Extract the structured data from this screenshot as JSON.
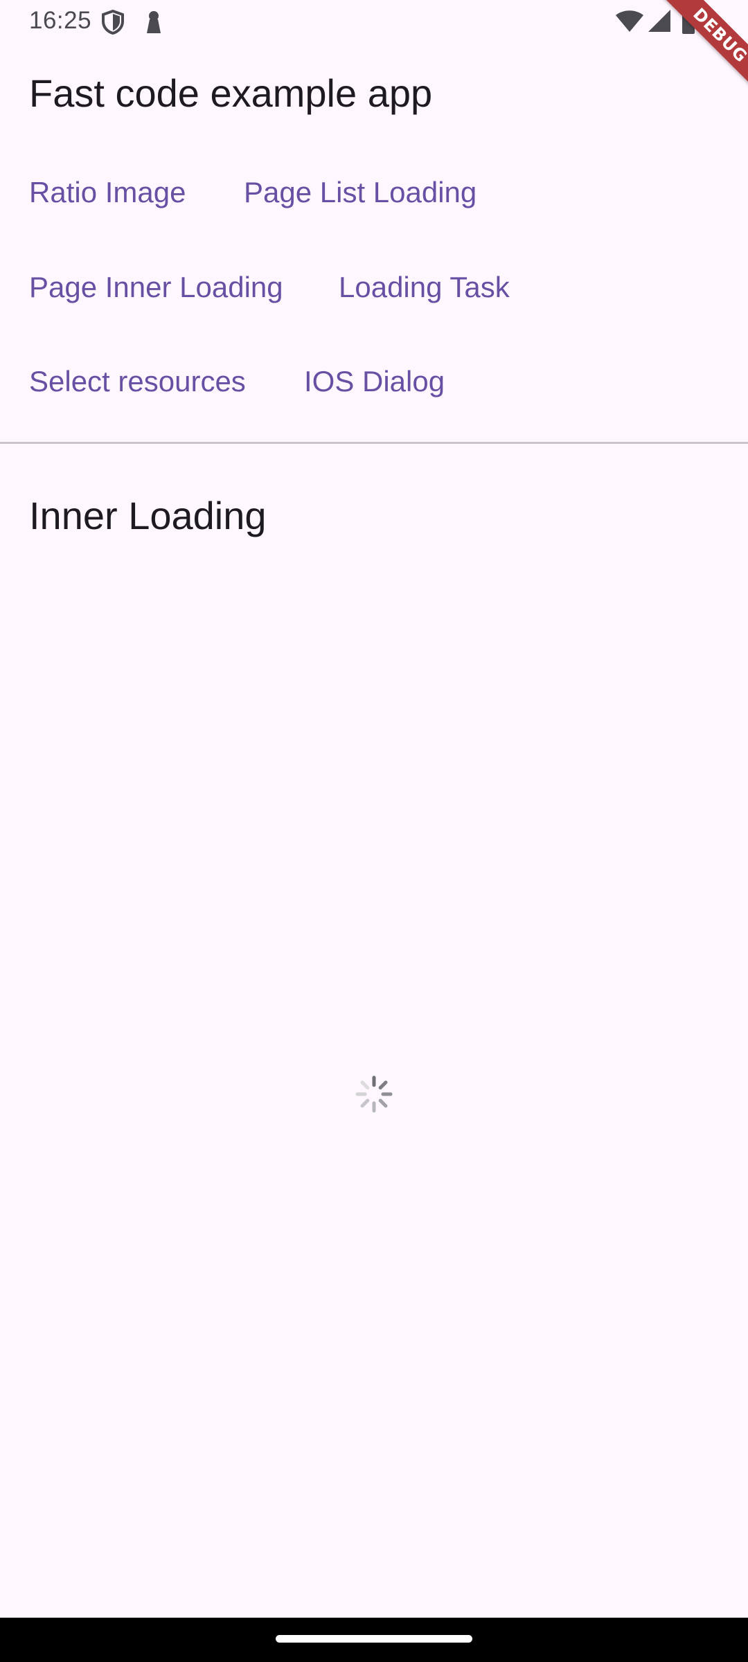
{
  "status_bar": {
    "time": "16:25",
    "left_icons": [
      "shield-icon",
      "keyhole-icon"
    ],
    "right_icons": [
      "wifi-icon",
      "signal-icon",
      "battery-icon",
      "notification-dot-icon"
    ]
  },
  "app_bar": {
    "title": "Fast code example app"
  },
  "buttons": [
    {
      "label": "Ratio Image"
    },
    {
      "label": "Page List Loading"
    },
    {
      "label": "Page Inner Loading"
    },
    {
      "label": "Loading Task"
    },
    {
      "label": "Select resources"
    },
    {
      "label": "IOS Dialog"
    }
  ],
  "section": {
    "title": "Inner Loading"
  },
  "debug_banner": {
    "label": "DEBUG"
  },
  "colors": {
    "background": "#fef7fe",
    "accent": "#6750a4",
    "text": "#1d1b20",
    "debug": "#b2393c"
  }
}
